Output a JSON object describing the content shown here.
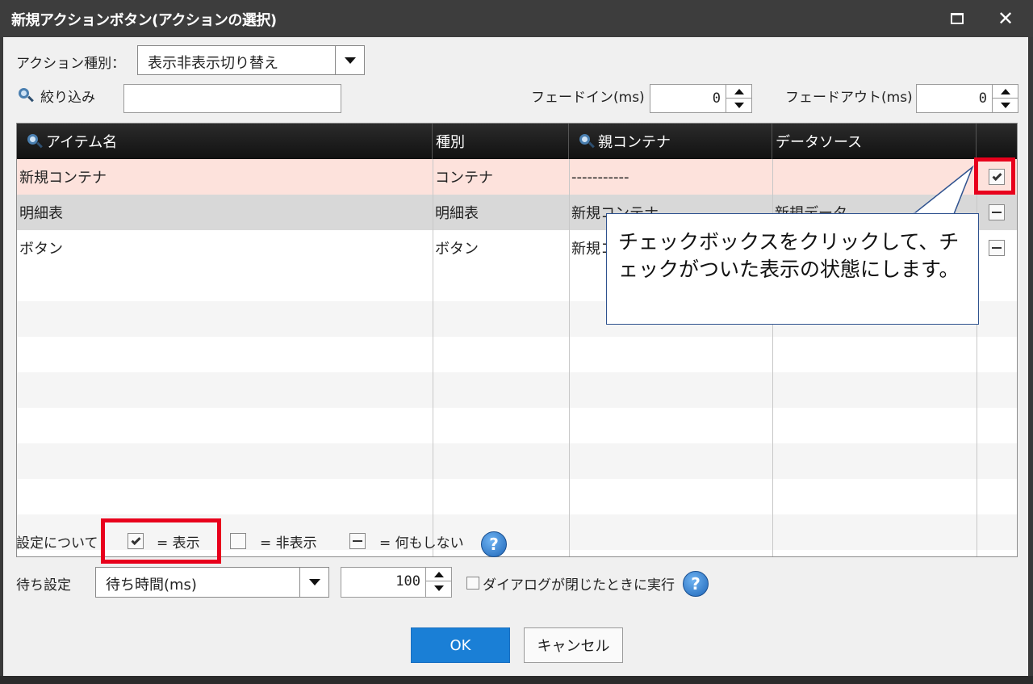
{
  "window": {
    "title": "新規アクションボタン(アクションの選択)",
    "maximize_icon": "maximize-icon",
    "close_icon": "close-icon",
    "close_glyph": "✕"
  },
  "action_type": {
    "label": "アクション種別：",
    "selected": "表示非表示切り替え"
  },
  "filter": {
    "label": "絞り込み",
    "value": ""
  },
  "fade_in": {
    "label": "フェードイン(ms)",
    "value": "0"
  },
  "fade_out": {
    "label": "フェードアウト(ms)",
    "value": "0"
  },
  "grid": {
    "columns": [
      "アイテム名",
      "種別",
      "親コンテナ",
      "データソース",
      ""
    ],
    "rows": [
      {
        "name": "新規コンテナ",
        "type": "コンテナ",
        "parent": "-----------",
        "datasource": "",
        "state": "checked"
      },
      {
        "name": "明細表",
        "type": "明細表",
        "parent": "新規コンテナ",
        "datasource": "新規データ",
        "state": "none"
      },
      {
        "name": "ボタン",
        "type": "ボタン",
        "parent": "新規コ",
        "datasource": "",
        "state": "none"
      }
    ],
    "selected_row_color": "#fde2dc",
    "alt_row_color": "#d8d8d8"
  },
  "callout": {
    "text": "チェックボックスをクリックして、チェックがついた表示の状態にします。"
  },
  "legend": {
    "label": "設定について",
    "show": "= 表示",
    "hide": "= 非表示",
    "nothing": "= 何もしない"
  },
  "wait": {
    "label": "待ち設定",
    "selected": "待ち時間(ms)",
    "value": "100",
    "dialog_close_label": "ダイアログが閉じたときに実行"
  },
  "help_glyph": "?",
  "buttons": {
    "ok": "OK",
    "cancel": "キャンセル"
  },
  "colors": {
    "accent": "#1a7fd6",
    "highlight": "#e8001c"
  }
}
